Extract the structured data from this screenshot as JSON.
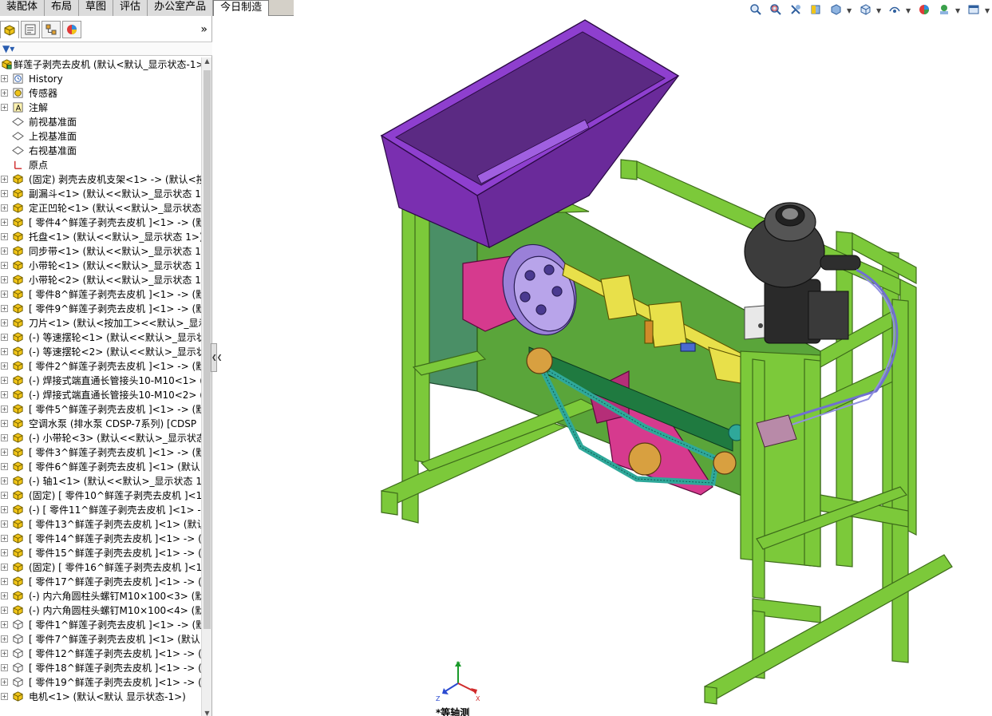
{
  "tabs": [
    {
      "label": "装配体"
    },
    {
      "label": "布局"
    },
    {
      "label": "草图"
    },
    {
      "label": "评估"
    },
    {
      "label": "办公室产品"
    },
    {
      "label": "今日制造",
      "active": true
    }
  ],
  "panel": {
    "tool_icons": [
      "feature-manager-icon",
      "property-manager-icon",
      "configuration-manager-icon",
      "appearance-icon"
    ],
    "expand_label": "»"
  },
  "tree": {
    "root": "鲜莲子剥壳去皮机 (默认<默认_显示状态-1>",
    "items": [
      {
        "label": "History",
        "icon": "history-icon"
      },
      {
        "label": "传感器",
        "icon": "sensor-icon"
      },
      {
        "label": "注解",
        "icon": "annotation-icon"
      },
      {
        "label": "前视基准面",
        "icon": "plane-icon"
      },
      {
        "label": "上视基准面",
        "icon": "plane-icon"
      },
      {
        "label": "右视基准面",
        "icon": "plane-icon"
      },
      {
        "label": "原点",
        "icon": "origin-icon"
      },
      {
        "label": "(固定) 剥壳去皮机支架<1> -> (默认<按",
        "icon": "part-icon"
      },
      {
        "label": "副漏斗<1> (默认<<默认>_显示状态 1>",
        "icon": "part-icon"
      },
      {
        "label": "定正凹轮<1> (默认<<默认>_显示状态",
        "icon": "part-icon"
      },
      {
        "label": "[ 零件4^鲜莲子剥壳去皮机 ]<1> -> (默",
        "icon": "part-icon"
      },
      {
        "label": "托盘<1> (默认<<默认>_显示状态 1>)",
        "icon": "part-icon"
      },
      {
        "label": "同步带<1> (默认<<默认>_显示状态 1>",
        "icon": "part-icon"
      },
      {
        "label": "小带轮<1> (默认<<默认>_显示状态 1>",
        "icon": "part-icon"
      },
      {
        "label": "小带轮<2> (默认<<默认>_显示状态 1>",
        "icon": "part-icon"
      },
      {
        "label": "[ 零件8^鲜莲子剥壳去皮机 ]<1> -> (默",
        "icon": "part-icon"
      },
      {
        "label": "[ 零件9^鲜莲子剥壳去皮机 ]<1> -> (默",
        "icon": "part-icon"
      },
      {
        "label": "刀片<1> (默认<按加工><<默认>_显示",
        "icon": "part-icon"
      },
      {
        "label": "(-) 等速摆轮<1> (默认<<默认>_显示状",
        "icon": "part-icon"
      },
      {
        "label": "(-) 等速摆轮<2> (默认<<默认>_显示状",
        "icon": "part-icon"
      },
      {
        "label": "[ 零件2^鲜莲子剥壳去皮机 ]<1> -> (默",
        "icon": "part-icon"
      },
      {
        "label": "(-) 焊接式端直通长管接头10-M10<1> (",
        "icon": "part-icon"
      },
      {
        "label": "(-) 焊接式端直通长管接头10-M10<2> (",
        "icon": "part-icon"
      },
      {
        "label": "[ 零件5^鲜莲子剥壳去皮机 ]<1> -> (默",
        "icon": "part-icon"
      },
      {
        "label": "空调水泵 (排水泵 CDSP-7系列) [CDSP",
        "icon": "part-icon"
      },
      {
        "label": "(-) 小带轮<3> (默认<<默认>_显示状态",
        "icon": "part-icon"
      },
      {
        "label": "[ 零件3^鲜莲子剥壳去皮机 ]<1> -> (默",
        "icon": "part-icon"
      },
      {
        "label": "[ 零件6^鲜莲子剥壳去皮机 ]<1> (默认<",
        "icon": "part-icon"
      },
      {
        "label": "(-) 轴1<1> (默认<<默认>_显示状态 1>",
        "icon": "part-icon"
      },
      {
        "label": "(固定) [ 零件10^鲜莲子剥壳去皮机 ]<1>",
        "icon": "part-icon"
      },
      {
        "label": "(-) [ 零件11^鲜莲子剥壳去皮机 ]<1> ->",
        "icon": "part-icon"
      },
      {
        "label": "[ 零件13^鲜莲子剥壳去皮机 ]<1> (默认",
        "icon": "part-icon"
      },
      {
        "label": "[ 零件14^鲜莲子剥壳去皮机 ]<1> -> (默",
        "icon": "part-icon"
      },
      {
        "label": "[ 零件15^鲜莲子剥壳去皮机 ]<1> -> (默",
        "icon": "part-icon"
      },
      {
        "label": "(固定) [ 零件16^鲜莲子剥壳去皮机 ]<1>",
        "icon": "part-icon"
      },
      {
        "label": "[ 零件17^鲜莲子剥壳去皮机 ]<1> -> (默",
        "icon": "part-icon"
      },
      {
        "label": "(-) 内六角圆柱头螺钉M10×100<3> (默",
        "icon": "part-icon"
      },
      {
        "label": "(-) 内六角圆柱头螺钉M10×100<4> (默",
        "icon": "part-icon"
      },
      {
        "label": "[ 零件1^鲜莲子剥壳去皮机 ]<1> -> (默",
        "icon": "part-outline-icon"
      },
      {
        "label": "[ 零件7^鲜莲子剥壳去皮机 ]<1> (默认<",
        "icon": "part-outline-icon"
      },
      {
        "label": "[ 零件12^鲜莲子剥壳去皮机 ]<1> -> (默",
        "icon": "part-outline-icon"
      },
      {
        "label": "[ 零件18^鲜莲子剥壳去皮机 ]<1> -> (默",
        "icon": "part-outline-icon"
      },
      {
        "label": "[ 零件19^鲜莲子剥壳去皮机 ]<1> -> (默",
        "icon": "part-outline-icon"
      },
      {
        "label": "电机<1> (默认<默认 显示状态-1>)",
        "icon": "part-icon"
      }
    ]
  },
  "viewport": {
    "view_name": "*等轴测",
    "triad": {
      "y": "Y",
      "z": "Z",
      "x": "X"
    },
    "colors": {
      "frame": "#7cc93a",
      "hopper": "#7a2fb0",
      "panel": "#5aa53a",
      "side_panel": "#4a8f66",
      "magenta": "#d63a8e",
      "yellow": "#e8e04a",
      "belt": "#2fa89a",
      "motor": "#333333",
      "violet": "#9a80d8"
    }
  },
  "hud": {
    "icons": [
      "zoom-to-fit-icon",
      "zoom-to-area-icon",
      "previous-view-icon",
      "section-view-icon",
      "dynamic-annotation-icon",
      "view-orientation-icon",
      "display-style-icon",
      "hide-show-items-icon",
      "edit-appearance-icon",
      "apply-scene-icon",
      "view-settings-icon"
    ]
  }
}
